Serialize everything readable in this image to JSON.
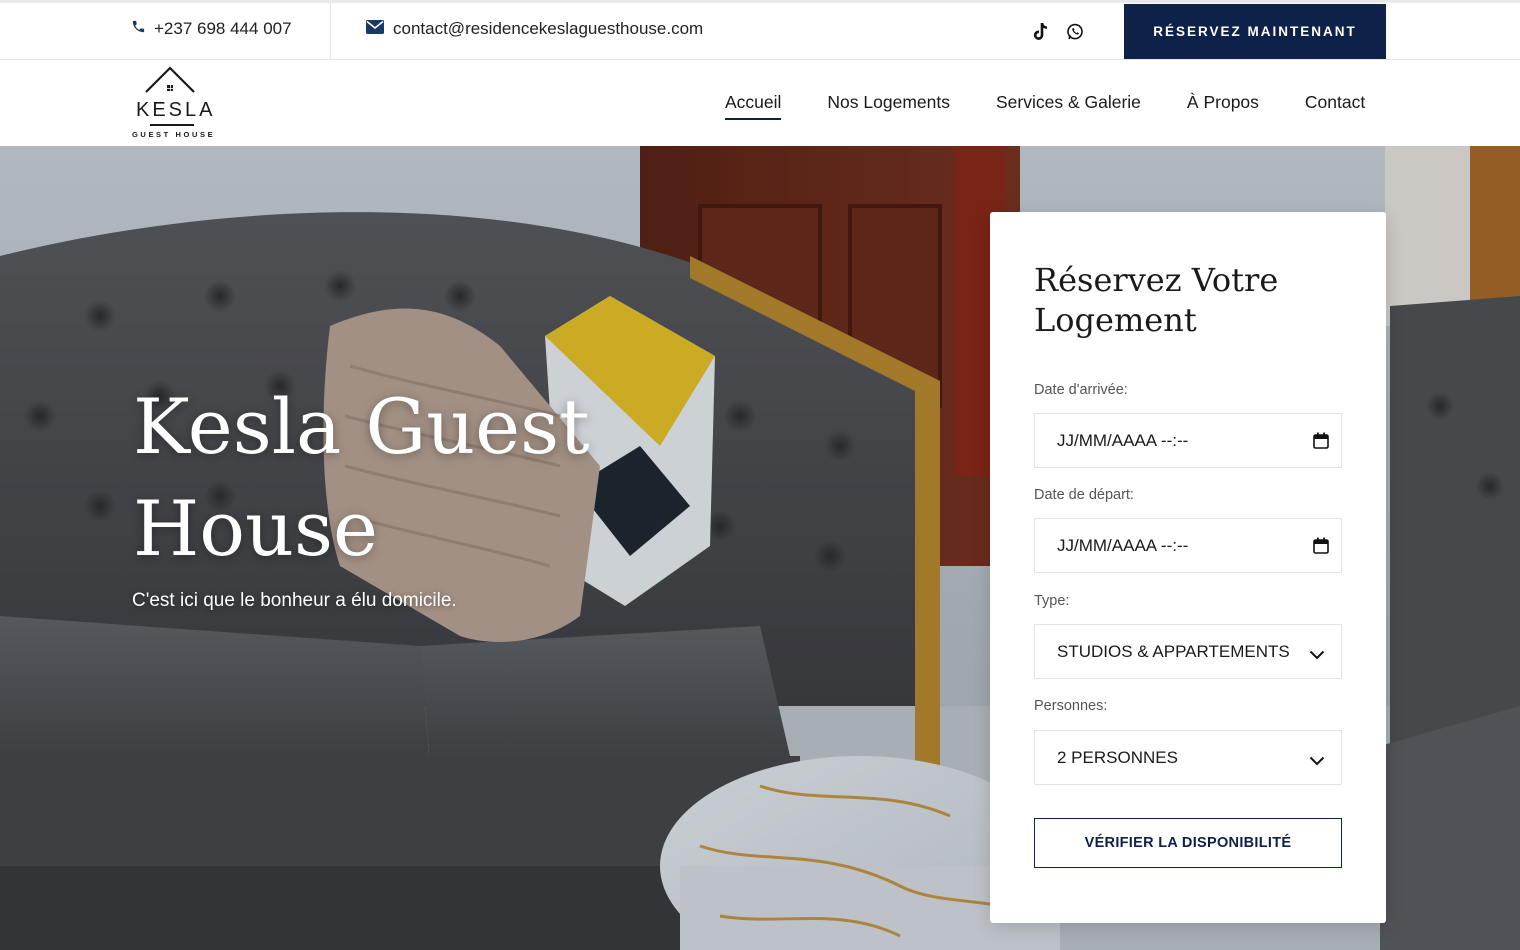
{
  "topbar": {
    "phone": "+237 698 444 007",
    "email": "contact@residencekeslaguesthouse.com",
    "social_icons": [
      "tiktok-icon",
      "whatsapp-icon"
    ],
    "cta_label": "RÉSERVEZ MAINTENANT"
  },
  "logo": {
    "brand": "KESLA",
    "sub": "GUEST HOUSE"
  },
  "nav": {
    "items": [
      {
        "label": "Accueil",
        "active": true
      },
      {
        "label": "Nos Logements",
        "active": false
      },
      {
        "label": "Services & Galerie",
        "active": false
      },
      {
        "label": "À Propos",
        "active": false
      },
      {
        "label": "Contact",
        "active": false
      }
    ]
  },
  "hero": {
    "title_line1": "Kesla Guest",
    "title_line2": "House",
    "subtitle": "C'est ici que le bonheur a élu domicile."
  },
  "booking": {
    "title": "Réservez Votre Logement",
    "arrival_label": "Date d'arrivée:",
    "arrival_value": "JJ/MM/AAAA --:--",
    "departure_label": "Date de départ:",
    "departure_value": "JJ/MM/AAAA --:--",
    "type_label": "Type:",
    "type_value": "STUDIOS & APPARTEMENTS",
    "persons_label": "Personnes:",
    "persons_value": "2 PERSONNES",
    "submit_label": "VÉRIFIER LA DISPONIBILITÉ"
  },
  "colors": {
    "navy": "#0e2148",
    "white": "#ffffff"
  }
}
